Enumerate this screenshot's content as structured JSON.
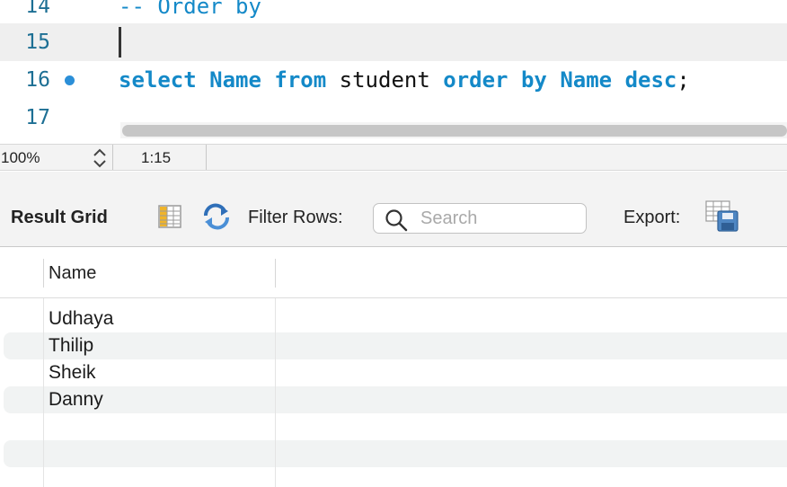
{
  "editor": {
    "lines": [
      {
        "number": "14",
        "tokens": [
          {
            "text": "-- Order by",
            "cls": "cmt"
          }
        ]
      },
      {
        "number": "15",
        "tokens": []
      },
      {
        "number": "16",
        "tokens": [
          {
            "text": "select",
            "cls": "kw"
          },
          {
            "text": " ",
            "cls": "id"
          },
          {
            "text": "Name",
            "cls": "kw"
          },
          {
            "text": " ",
            "cls": "id"
          },
          {
            "text": "from",
            "cls": "kw"
          },
          {
            "text": " student ",
            "cls": "id"
          },
          {
            "text": "order",
            "cls": "kw"
          },
          {
            "text": " ",
            "cls": "id"
          },
          {
            "text": "by",
            "cls": "kw"
          },
          {
            "text": " ",
            "cls": "id"
          },
          {
            "text": "Name",
            "cls": "kw"
          },
          {
            "text": " ",
            "cls": "id"
          },
          {
            "text": "desc",
            "cls": "kw"
          },
          {
            "text": ";",
            "cls": "id"
          }
        ]
      },
      {
        "number": "17",
        "tokens": []
      }
    ]
  },
  "status": {
    "zoom": "100%",
    "cursor": "1:15"
  },
  "result_toolbar": {
    "tab_label": "Result Grid",
    "filter_label": "Filter Rows:",
    "search_placeholder": "Search",
    "search_value": "",
    "export_label": "Export:"
  },
  "grid": {
    "columns": [
      "Name"
    ],
    "rows": [
      [
        "Udhaya"
      ],
      [
        "Thilip"
      ],
      [
        "Sheik"
      ],
      [
        "Danny"
      ],
      [
        ""
      ],
      [
        ""
      ]
    ]
  },
  "colors": {
    "keyword": "#1489c8",
    "line_number": "#1d6f94",
    "breakpoint_dot": "#2b8fd8"
  },
  "icons": {
    "stepper": "up-down-chevron-icon",
    "grid": "grid-columns-icon",
    "refresh": "refresh-arrows-icon",
    "search": "magnifier-icon",
    "export": "export-table-disk-icon"
  }
}
